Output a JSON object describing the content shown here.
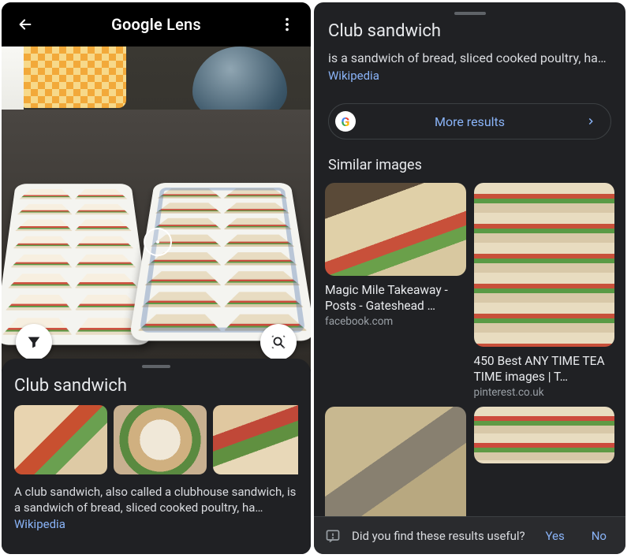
{
  "left": {
    "app_title_prefix": "Google",
    "app_title_suffix": " Lens",
    "sheet": {
      "title": "Club sandwich",
      "description": "A club sandwich, also called a clubhouse sandwich, is a sandwich of bread, sliced cooked poultry, ha…",
      "source": "Wikipedia"
    }
  },
  "right": {
    "title": "Club sandwich",
    "description": "is a sandwich of bread, sliced cooked poultry, ha…",
    "source": "Wikipedia",
    "more_results": "More results",
    "similar_heading": "Similar images",
    "cards": {
      "a": {
        "title": "Magic Mile Takeaway - Posts - Gateshead …",
        "source": "facebook.com"
      },
      "b": {
        "title": "450 Best ANY TIME TEA TIME images | T…",
        "source": "pinterest.co.uk"
      }
    },
    "feedback": {
      "prompt": "Did you find these results useful?",
      "yes": "Yes",
      "no": "No"
    }
  }
}
